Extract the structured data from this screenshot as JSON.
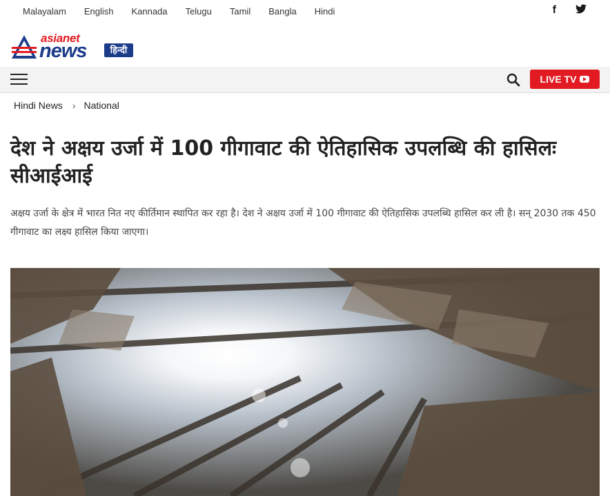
{
  "languages": [
    "Malayalam",
    "English",
    "Kannada",
    "Telugu",
    "Tamil",
    "Bangla",
    "Hindi"
  ],
  "social": {
    "facebook": "f",
    "twitter": "t"
  },
  "logo": {
    "small": "asianet",
    "big": "news",
    "hindi": "हिन्दी"
  },
  "header": {
    "live_label": "LIVE TV"
  },
  "breadcrumb": {
    "home": "Hindi News",
    "section": "National"
  },
  "article": {
    "headline": "देश ने अक्षय उर्जा में 100 गीगावाट की ऐतिहासिक उपलब्धि की हासिलः सीआईआई",
    "summary": "अक्षय उर्जा के क्षेत्र में भारत नित नए कीर्तिमान स्थापित कर रहा है। देश ने अक्षय उर्जा में 100 गीगावाट की ऐतिहासिक उपलब्धि हासिल कर ली है। सन् 2030 तक 450 गीगावाट का लक्ष्य हासिल किया जाएगा।"
  },
  "colors": {
    "brand_red": "#e21b22",
    "brand_blue": "#1c3c8a"
  }
}
